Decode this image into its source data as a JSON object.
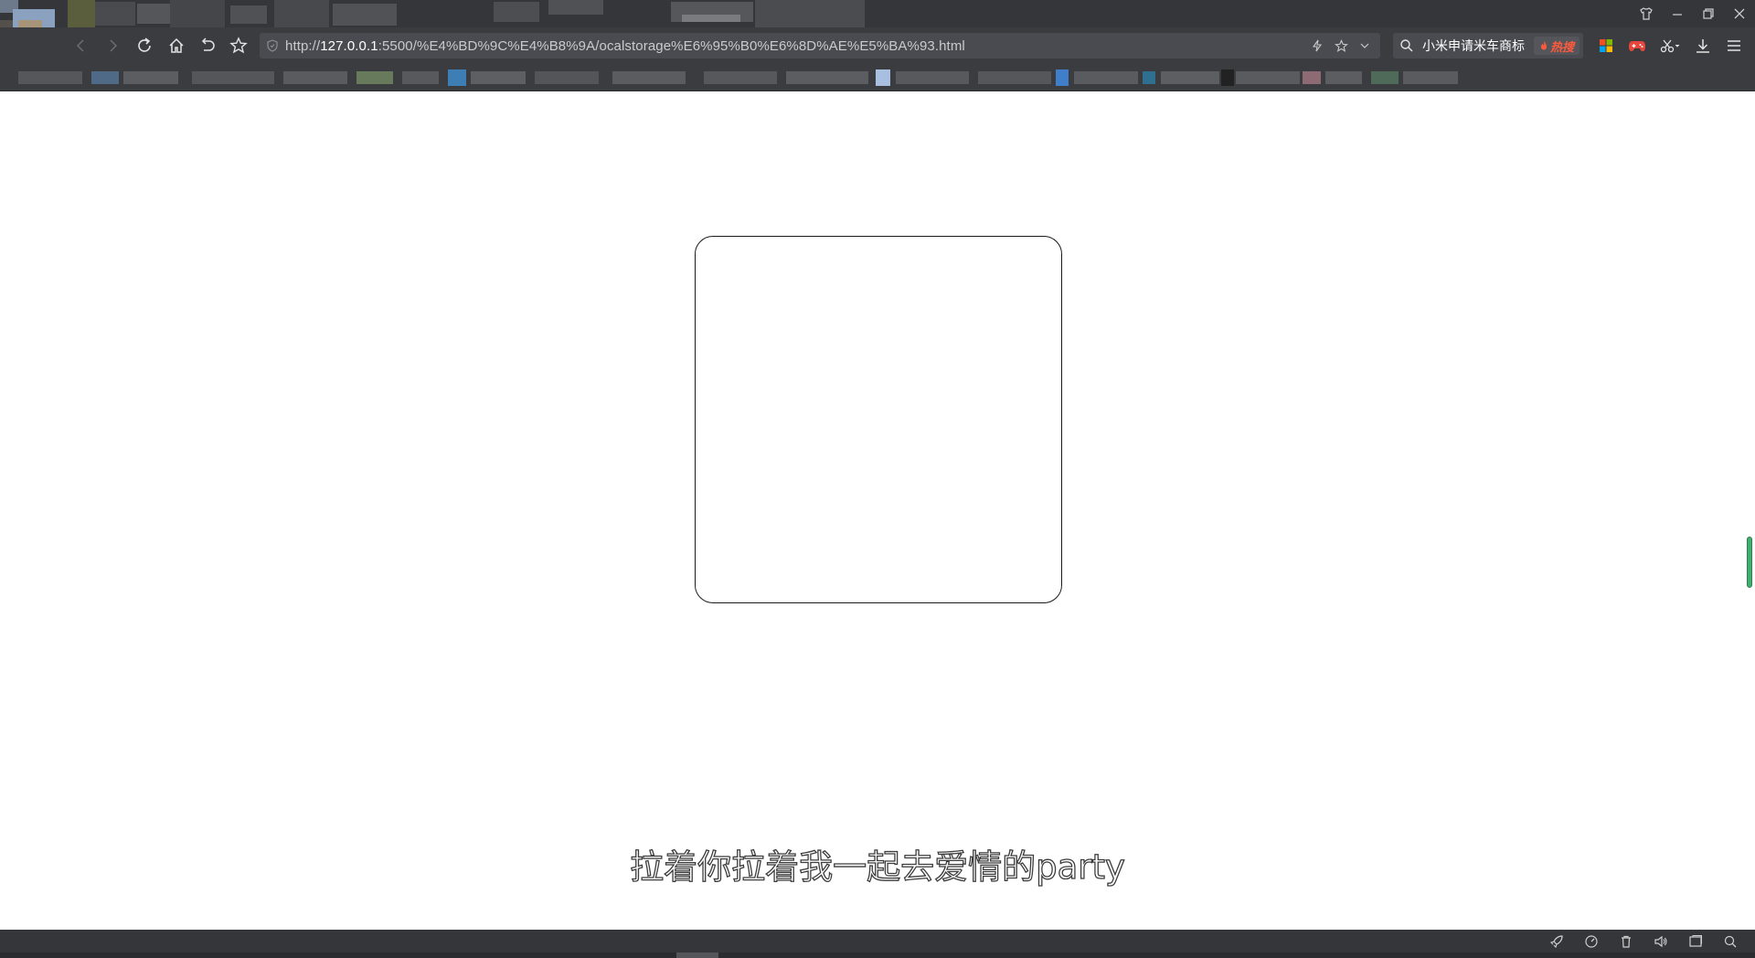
{
  "toolbar": {
    "url_prefix": "http://",
    "url_host": "127.0.0.1",
    "url_rest": ":5500/%E4%BD%9C%E4%B8%9A/ocalstorage%E6%95%B0%E6%8D%AE%E5%BA%93.html"
  },
  "search": {
    "text": "小米申请米车商标",
    "hot_label": "热搜"
  },
  "subtitle": {
    "text": "拉着你拉着我一起去爱情的party"
  },
  "colors": {
    "chrome_dark": "#35363a",
    "toolbar": "#3b3c40",
    "field": "#4a4b50",
    "hot": "#ff5a3c",
    "scroll_indicator": "#3fae6e"
  }
}
